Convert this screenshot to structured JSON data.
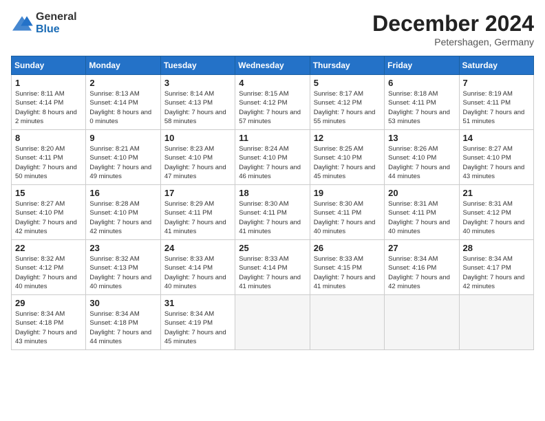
{
  "header": {
    "logo_general": "General",
    "logo_blue": "Blue",
    "month_title": "December 2024",
    "location": "Petershagen, Germany"
  },
  "weekdays": [
    "Sunday",
    "Monday",
    "Tuesday",
    "Wednesday",
    "Thursday",
    "Friday",
    "Saturday"
  ],
  "weeks": [
    [
      {
        "day": "1",
        "sunrise": "8:11 AM",
        "sunset": "4:14 PM",
        "daylight": "8 hours and 2 minutes."
      },
      {
        "day": "2",
        "sunrise": "8:13 AM",
        "sunset": "4:14 PM",
        "daylight": "8 hours and 0 minutes."
      },
      {
        "day": "3",
        "sunrise": "8:14 AM",
        "sunset": "4:13 PM",
        "daylight": "7 hours and 58 minutes."
      },
      {
        "day": "4",
        "sunrise": "8:15 AM",
        "sunset": "4:12 PM",
        "daylight": "7 hours and 57 minutes."
      },
      {
        "day": "5",
        "sunrise": "8:17 AM",
        "sunset": "4:12 PM",
        "daylight": "7 hours and 55 minutes."
      },
      {
        "day": "6",
        "sunrise": "8:18 AM",
        "sunset": "4:11 PM",
        "daylight": "7 hours and 53 minutes."
      },
      {
        "day": "7",
        "sunrise": "8:19 AM",
        "sunset": "4:11 PM",
        "daylight": "7 hours and 51 minutes."
      }
    ],
    [
      {
        "day": "8",
        "sunrise": "8:20 AM",
        "sunset": "4:11 PM",
        "daylight": "7 hours and 50 minutes."
      },
      {
        "day": "9",
        "sunrise": "8:21 AM",
        "sunset": "4:10 PM",
        "daylight": "7 hours and 49 minutes."
      },
      {
        "day": "10",
        "sunrise": "8:23 AM",
        "sunset": "4:10 PM",
        "daylight": "7 hours and 47 minutes."
      },
      {
        "day": "11",
        "sunrise": "8:24 AM",
        "sunset": "4:10 PM",
        "daylight": "7 hours and 46 minutes."
      },
      {
        "day": "12",
        "sunrise": "8:25 AM",
        "sunset": "4:10 PM",
        "daylight": "7 hours and 45 minutes."
      },
      {
        "day": "13",
        "sunrise": "8:26 AM",
        "sunset": "4:10 PM",
        "daylight": "7 hours and 44 minutes."
      },
      {
        "day": "14",
        "sunrise": "8:27 AM",
        "sunset": "4:10 PM",
        "daylight": "7 hours and 43 minutes."
      }
    ],
    [
      {
        "day": "15",
        "sunrise": "8:27 AM",
        "sunset": "4:10 PM",
        "daylight": "7 hours and 42 minutes."
      },
      {
        "day": "16",
        "sunrise": "8:28 AM",
        "sunset": "4:10 PM",
        "daylight": "7 hours and 42 minutes."
      },
      {
        "day": "17",
        "sunrise": "8:29 AM",
        "sunset": "4:11 PM",
        "daylight": "7 hours and 41 minutes."
      },
      {
        "day": "18",
        "sunrise": "8:30 AM",
        "sunset": "4:11 PM",
        "daylight": "7 hours and 41 minutes."
      },
      {
        "day": "19",
        "sunrise": "8:30 AM",
        "sunset": "4:11 PM",
        "daylight": "7 hours and 40 minutes."
      },
      {
        "day": "20",
        "sunrise": "8:31 AM",
        "sunset": "4:11 PM",
        "daylight": "7 hours and 40 minutes."
      },
      {
        "day": "21",
        "sunrise": "8:31 AM",
        "sunset": "4:12 PM",
        "daylight": "7 hours and 40 minutes."
      }
    ],
    [
      {
        "day": "22",
        "sunrise": "8:32 AM",
        "sunset": "4:12 PM",
        "daylight": "7 hours and 40 minutes."
      },
      {
        "day": "23",
        "sunrise": "8:32 AM",
        "sunset": "4:13 PM",
        "daylight": "7 hours and 40 minutes."
      },
      {
        "day": "24",
        "sunrise": "8:33 AM",
        "sunset": "4:14 PM",
        "daylight": "7 hours and 40 minutes."
      },
      {
        "day": "25",
        "sunrise": "8:33 AM",
        "sunset": "4:14 PM",
        "daylight": "7 hours and 41 minutes."
      },
      {
        "day": "26",
        "sunrise": "8:33 AM",
        "sunset": "4:15 PM",
        "daylight": "7 hours and 41 minutes."
      },
      {
        "day": "27",
        "sunrise": "8:34 AM",
        "sunset": "4:16 PM",
        "daylight": "7 hours and 42 minutes."
      },
      {
        "day": "28",
        "sunrise": "8:34 AM",
        "sunset": "4:17 PM",
        "daylight": "7 hours and 42 minutes."
      }
    ],
    [
      {
        "day": "29",
        "sunrise": "8:34 AM",
        "sunset": "4:18 PM",
        "daylight": "7 hours and 43 minutes."
      },
      {
        "day": "30",
        "sunrise": "8:34 AM",
        "sunset": "4:18 PM",
        "daylight": "7 hours and 44 minutes."
      },
      {
        "day": "31",
        "sunrise": "8:34 AM",
        "sunset": "4:19 PM",
        "daylight": "7 hours and 45 minutes."
      },
      null,
      null,
      null,
      null
    ]
  ]
}
